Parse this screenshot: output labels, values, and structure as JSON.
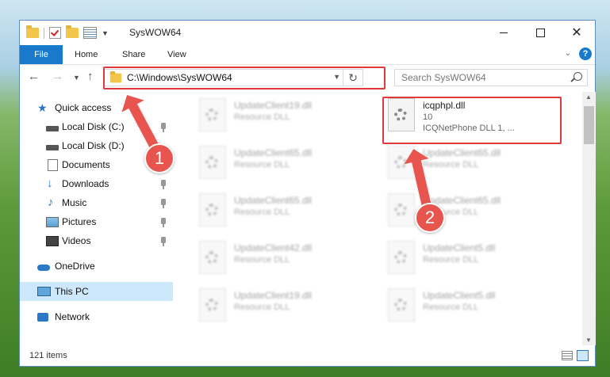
{
  "window": {
    "title": "SysWOW64"
  },
  "ribbon": {
    "tabs": [
      {
        "label": "File"
      },
      {
        "label": "Home"
      },
      {
        "label": "Share"
      },
      {
        "label": "View"
      }
    ]
  },
  "address": {
    "path": "C:\\Windows\\SysWOW64"
  },
  "search": {
    "placeholder": "Search SysWOW64"
  },
  "sidebar": {
    "items": [
      {
        "label": "Quick access",
        "icon": "star-icon"
      },
      {
        "label": "Local Disk (C:)",
        "icon": "drive-icon",
        "pinned": true
      },
      {
        "label": "Local Disk (D:)",
        "icon": "drive-icon",
        "pinned": false
      },
      {
        "label": "Documents",
        "icon": "documents-icon",
        "pinned": true
      },
      {
        "label": "Downloads",
        "icon": "download-icon",
        "pinned": true
      },
      {
        "label": "Music",
        "icon": "music-icon",
        "pinned": true
      },
      {
        "label": "Pictures",
        "icon": "pictures-icon",
        "pinned": true
      },
      {
        "label": "Videos",
        "icon": "videos-icon",
        "pinned": true
      },
      {
        "label": "OneDrive",
        "icon": "cloud-icon"
      },
      {
        "label": "This PC",
        "icon": "computer-icon",
        "selected": true
      },
      {
        "label": "Network",
        "icon": "network-icon"
      }
    ]
  },
  "files": {
    "highlighted": {
      "name": "icqphpl.dll",
      "line2": "10",
      "line3": "ICQNetPhone DLL 1, ..."
    },
    "left": [
      {
        "name": "UpdateClient19.dll",
        "desc": "Resource DLL"
      },
      {
        "name": "UpdateClient65.dll",
        "desc": "Resource DLL"
      },
      {
        "name": "UpdateClient65.dll",
        "desc": "Resource DLL"
      },
      {
        "name": "UpdateClient42.dll",
        "desc": "Resource DLL"
      },
      {
        "name": "UpdateClient19.dll",
        "desc": "Resource DLL"
      }
    ],
    "right": [
      {
        "name": "UpdateClient65.dll",
        "desc": "Resource DLL"
      },
      {
        "name": "UpdateClient65.dll",
        "desc": "Resource DLL"
      },
      {
        "name": "UpdateClient5.dll",
        "desc": "Resource DLL"
      },
      {
        "name": "UpdateClient5.dll",
        "desc": "Resource DLL"
      }
    ]
  },
  "status": {
    "item_count": "121 items"
  },
  "callouts": {
    "one": "1",
    "two": "2"
  },
  "colors": {
    "accent": "#1979ca",
    "highlight": "#e03b3b",
    "callout": "#e8554e",
    "selected": "#cde8fb"
  }
}
